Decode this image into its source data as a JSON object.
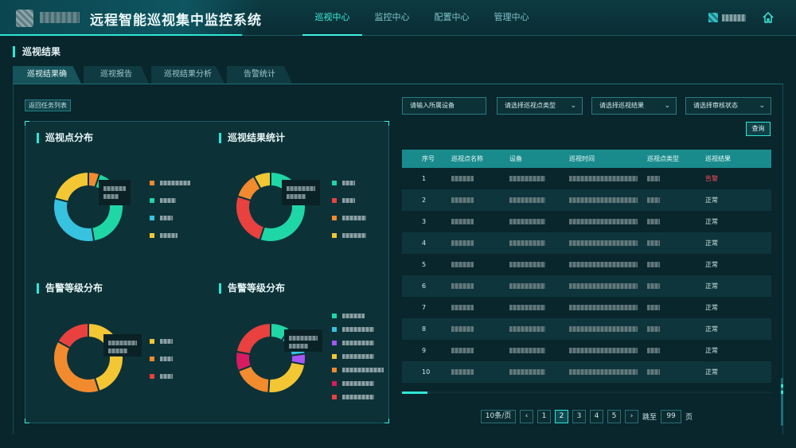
{
  "header": {
    "app_title": "远程智能巡视集中监控系统",
    "nav": [
      {
        "label": "巡视中心",
        "active": true
      },
      {
        "label": "监控中心",
        "active": false
      },
      {
        "label": "配置中心",
        "active": false
      },
      {
        "label": "管理中心",
        "active": false
      }
    ],
    "home_icon": "home-icon"
  },
  "section_title": "巡视结果",
  "tabs": [
    {
      "label": "巡视结果确认",
      "active": true
    },
    {
      "label": "巡视报告",
      "active": false
    },
    {
      "label": "巡视结果分析",
      "active": false
    },
    {
      "label": "告警统计",
      "active": false
    }
  ],
  "back_button": "返回任务列表",
  "charts": [
    {
      "title": "巡视点分布",
      "colors": [
        "#f28a2e",
        "#1fd6a6",
        "#37c2e0",
        "#f3c634"
      ],
      "values": [
        5,
        40,
        30,
        20
      ]
    },
    {
      "title": "巡视结果统计",
      "colors": [
        "#1fd6a6",
        "#e8413f",
        "#f28a2e",
        "#f3c634"
      ],
      "values": [
        55,
        25,
        12,
        8
      ]
    },
    {
      "title": "告警等级分布",
      "colors": [
        "#f3c634",
        "#f28a2e",
        "#e8413f"
      ],
      "values": [
        45,
        38,
        17
      ]
    },
    {
      "title": "告警等级分布",
      "colors": [
        "#1fd6a6",
        "#37c2e0",
        "#a855f7",
        "#f3c634",
        "#f28a2e",
        "#d81b60",
        "#e8413f"
      ],
      "values": [
        9,
        14,
        5,
        23,
        18,
        9,
        22
      ]
    }
  ],
  "filters": {
    "device_placeholder": "请输入所属设备",
    "point_type": "请选择巡视点类型",
    "result": "请选择巡视结果",
    "review_status": "请选择审核状态"
  },
  "query_button": "查询",
  "table": {
    "headers": [
      "序号",
      "巡视点名称",
      "设备",
      "巡视时间",
      "巡视点类型",
      "巡视结果"
    ],
    "rows": [
      {
        "index": "1",
        "result": "告警",
        "alert": true
      },
      {
        "index": "2",
        "result": "正常",
        "alert": false
      },
      {
        "index": "3",
        "result": "正常",
        "alert": false
      },
      {
        "index": "4",
        "result": "正常",
        "alert": false
      },
      {
        "index": "5",
        "result": "正常",
        "alert": false
      },
      {
        "index": "6",
        "result": "正常",
        "alert": false
      },
      {
        "index": "7",
        "result": "正常",
        "alert": false
      },
      {
        "index": "8",
        "result": "正常",
        "alert": false
      },
      {
        "index": "9",
        "result": "正常",
        "alert": false
      },
      {
        "index": "10",
        "result": "正常",
        "alert": false
      }
    ]
  },
  "pagination": {
    "page_size": "10条/页",
    "pages": [
      "1",
      "2",
      "3",
      "4",
      "5"
    ],
    "current": "2",
    "goto_label": "跳至",
    "goto_value": "99",
    "page_unit": "页",
    "prev": "‹",
    "next": "›"
  }
}
